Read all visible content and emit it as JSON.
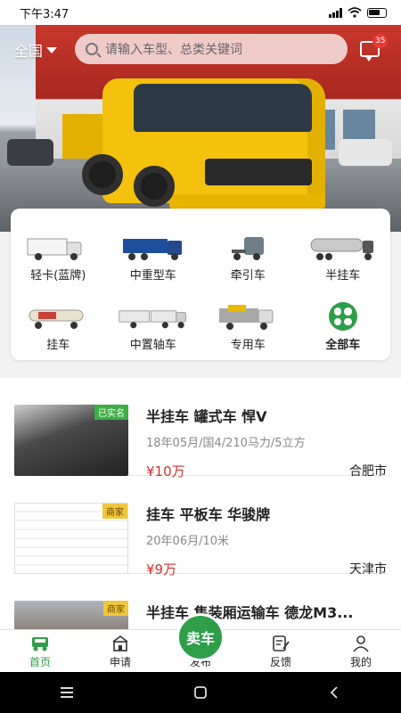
{
  "status_bar": {
    "time": "下午3:47"
  },
  "header": {
    "region": "全国",
    "search_placeholder": "请输入车型、总类关键词",
    "message_count": "35"
  },
  "categories": [
    {
      "label": "轻卡(蓝牌)"
    },
    {
      "label": "中重型车"
    },
    {
      "label": "牵引车"
    },
    {
      "label": "半挂车"
    },
    {
      "label": "挂车"
    },
    {
      "label": "中置轴车"
    },
    {
      "label": "专用车"
    },
    {
      "label": "全部车"
    }
  ],
  "listings": [
    {
      "tag": "已实名",
      "title": "半挂车 罐式车 悍V",
      "spec": "18年05月/国4/210马力/5立方",
      "price": "¥10万",
      "city": "合肥市"
    },
    {
      "tag": "商家",
      "title": "挂车 平板车 华骏牌",
      "spec": "20年06月/10米",
      "price": "¥9万",
      "city": "天津市"
    },
    {
      "tag": "商家",
      "title": "半挂车 集装厢运输车 德龙M3...",
      "spec": "",
      "price": "",
      "city": ""
    }
  ],
  "tabbar": {
    "home": "首页",
    "apply": "申请",
    "sell": "卖车",
    "publish": "发布",
    "feedback": "反馈",
    "mine": "我的"
  },
  "colors": {
    "brand_green": "#2e9e48",
    "price_red": "#d32f2f"
  }
}
